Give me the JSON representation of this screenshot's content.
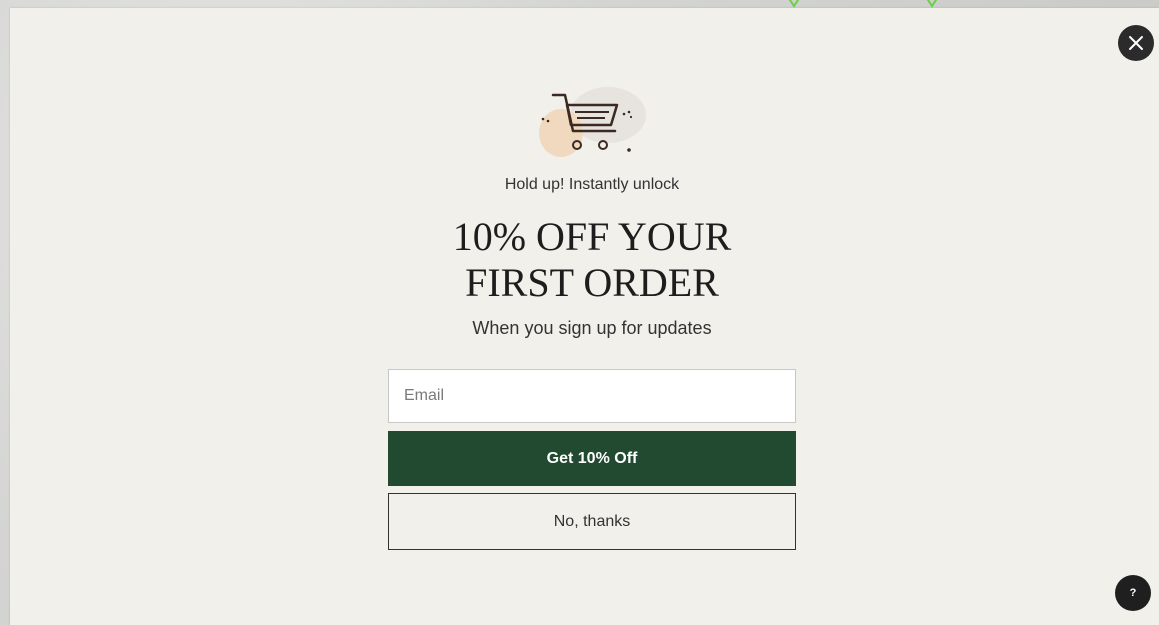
{
  "popup": {
    "kicker": "Hold up! Instantly unlock",
    "headline_line1": "10% OFF YOUR",
    "headline_line2": "FIRST ORDER",
    "subline": "When you sign up for updates",
    "email_placeholder": "Email",
    "email_value": "",
    "cta_label": "Get 10% Off",
    "decline_label": "No, thanks",
    "close_icon": "close-icon",
    "illustration_icon": "shopping-cart-icon"
  },
  "help": {
    "label": "?",
    "icon": "help-icon"
  },
  "colors": {
    "modal_bg": "#f2f0ea",
    "cta_bg": "#214a30",
    "close_bg": "#2b2b2b",
    "backdrop_chevron": "#6ad04a"
  }
}
